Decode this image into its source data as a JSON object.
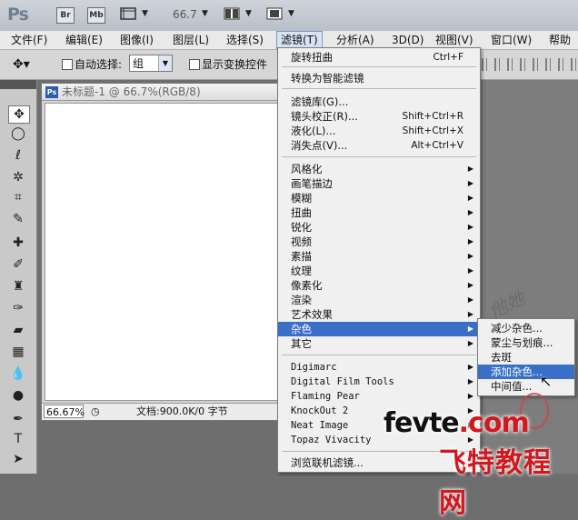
{
  "app": {
    "logo": "Ps",
    "bridge_btn": "Br",
    "minibridge_btn": "Mb",
    "zoom": "66.7"
  },
  "menubar": [
    {
      "label": "文件(F)"
    },
    {
      "label": "编辑(E)"
    },
    {
      "label": "图像(I)"
    },
    {
      "label": "图层(L)"
    },
    {
      "label": "选择(S)"
    },
    {
      "label": "滤镜(T)"
    },
    {
      "label": "分析(A)"
    },
    {
      "label": "3D(D)"
    },
    {
      "label": "视图(V)"
    },
    {
      "label": "窗口(W)"
    },
    {
      "label": "帮助(H)"
    }
  ],
  "options": {
    "auto_select_label": "自动选择:",
    "auto_select_value": "组",
    "show_transform_label": "显示变换控件"
  },
  "document": {
    "title": "未标题-1 @ 66.7%(RGB/8)",
    "zoom_field": "66.67%",
    "doc_info": "文档:900.0K/0 字节"
  },
  "filter_menu": {
    "items": [
      {
        "label": "旋转扭曲",
        "shortcut": "Ctrl+F"
      },
      {
        "label": "转换为智能滤镜"
      },
      {
        "label": "滤镜库(G)..."
      },
      {
        "label": "镜头校正(R)...",
        "shortcut": "Shift+Ctrl+R"
      },
      {
        "label": "液化(L)...",
        "shortcut": "Shift+Ctrl+X"
      },
      {
        "label": "消失点(V)...",
        "shortcut": "Alt+Ctrl+V"
      },
      {
        "label": "风格化"
      },
      {
        "label": "画笔描边"
      },
      {
        "label": "模糊"
      },
      {
        "label": "扭曲"
      },
      {
        "label": "锐化"
      },
      {
        "label": "视频"
      },
      {
        "label": "素描"
      },
      {
        "label": "纹理"
      },
      {
        "label": "像素化"
      },
      {
        "label": "渲染"
      },
      {
        "label": "艺术效果"
      },
      {
        "label": "杂色"
      },
      {
        "label": "其它"
      },
      {
        "label": "Digimarc"
      },
      {
        "label": "Digital Film Tools"
      },
      {
        "label": "Flaming Pear"
      },
      {
        "label": "KnockOut 2"
      },
      {
        "label": "Neat Image"
      },
      {
        "label": "Topaz Vivacity"
      },
      {
        "label": "浏览联机滤镜..."
      }
    ]
  },
  "noise_submenu": {
    "items": [
      {
        "label": "减少杂色..."
      },
      {
        "label": "蒙尘与划痕..."
      },
      {
        "label": "去斑"
      },
      {
        "label": "添加杂色..."
      },
      {
        "label": "中间值..."
      }
    ]
  },
  "watermark": {
    "site_black": "fevte",
    "site_red": ".com",
    "site_cn": "飞特教程网",
    "signature": "他她"
  },
  "colors": {
    "highlight": "#3a6fc7",
    "watermark_red": "#d0181e"
  }
}
